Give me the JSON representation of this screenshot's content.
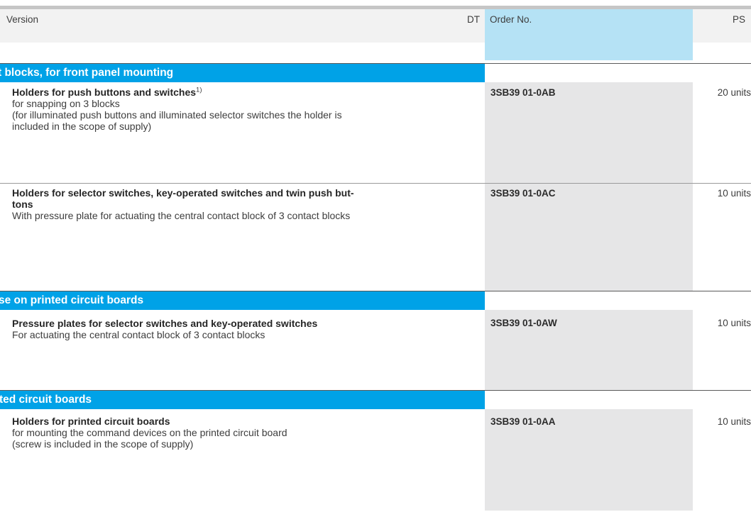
{
  "header": {
    "version_label": "Version",
    "dt_label": "DT",
    "order_label": "Order No.",
    "ps_label": "PS"
  },
  "colors": {
    "section_bar": "#00a2e7",
    "order_header": "#b5e2f5",
    "order_cell": "#e6e6e7",
    "header_gray": "#f2f2f2"
  },
  "sections": [
    {
      "title": "t blocks, for front panel mounting",
      "rows": [
        {
          "title": "Holders for push buttons and switches",
          "footnote": "1)",
          "lines": [
            "for snapping on 3 blocks",
            "(for illuminated push buttons and illuminated selector switches the holder is",
            "included in the scope of supply)"
          ],
          "order_no": "3SB39 01-0AB",
          "ps": "20 units"
        },
        {
          "title_line1": "Holders for selector switches, key-operated switches and twin push but-",
          "title_line2": "tons",
          "lines": [
            "With pressure plate for actuating the central contact block of 3 contact blocks"
          ],
          "order_no": "3SB39 01-0AC",
          "ps": "10 units"
        }
      ]
    },
    {
      "title": "se on printed circuit boards",
      "rows": [
        {
          "title": "Pressure plates for selector switches and key-operated switches",
          "lines": [
            "For actuating the central contact block of 3 contact blocks"
          ],
          "order_no": "3SB39 01-0AW",
          "ps": "10 units"
        }
      ]
    },
    {
      "title": "ted circuit boards",
      "rows": [
        {
          "title": "Holders for printed circuit boards",
          "lines": [
            "for mounting the command devices on the printed circuit board",
            "(screw is included in the scope of supply)"
          ],
          "order_no": "3SB39 01-0AA",
          "ps": "10 units"
        }
      ]
    }
  ]
}
